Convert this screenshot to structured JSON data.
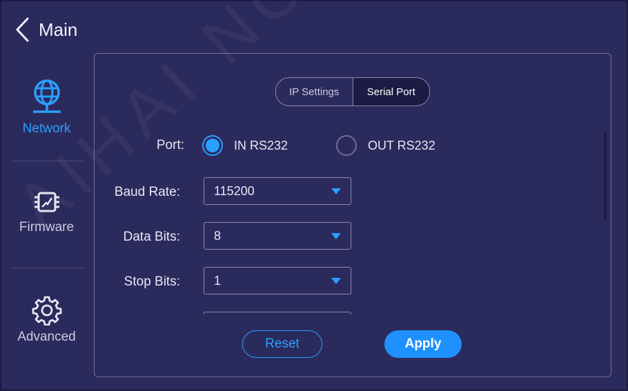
{
  "header": {
    "back_icon": "chevron-left-icon",
    "title": "Main"
  },
  "sidebar": {
    "items": [
      {
        "label": "Network",
        "icon": "globe-network-icon",
        "active": true
      },
      {
        "label": "Firmware",
        "icon": "chip-icon",
        "active": false
      },
      {
        "label": "Advanced",
        "icon": "gear-icon",
        "active": false
      }
    ]
  },
  "tabs": [
    {
      "label": "IP Settings",
      "active": false
    },
    {
      "label": "Serial Port",
      "active": true
    }
  ],
  "form": {
    "port_label": "Port:",
    "port_options": [
      {
        "label": "IN RS232",
        "selected": true
      },
      {
        "label": "OUT RS232",
        "selected": false
      }
    ],
    "baud_rate_label": "Baud Rate:",
    "baud_rate_value": "115200",
    "data_bits_label": "Data Bits:",
    "data_bits_value": "8",
    "stop_bits_label": "Stop Bits:",
    "stop_bits_value": "1"
  },
  "buttons": {
    "reset": "Reset",
    "apply": "Apply"
  },
  "watermark": "AIHAI NOVASTAR",
  "colors": {
    "accent": "#2aa0ff",
    "background": "#2b2a5c",
    "dark_tab": "#1c1b44"
  }
}
